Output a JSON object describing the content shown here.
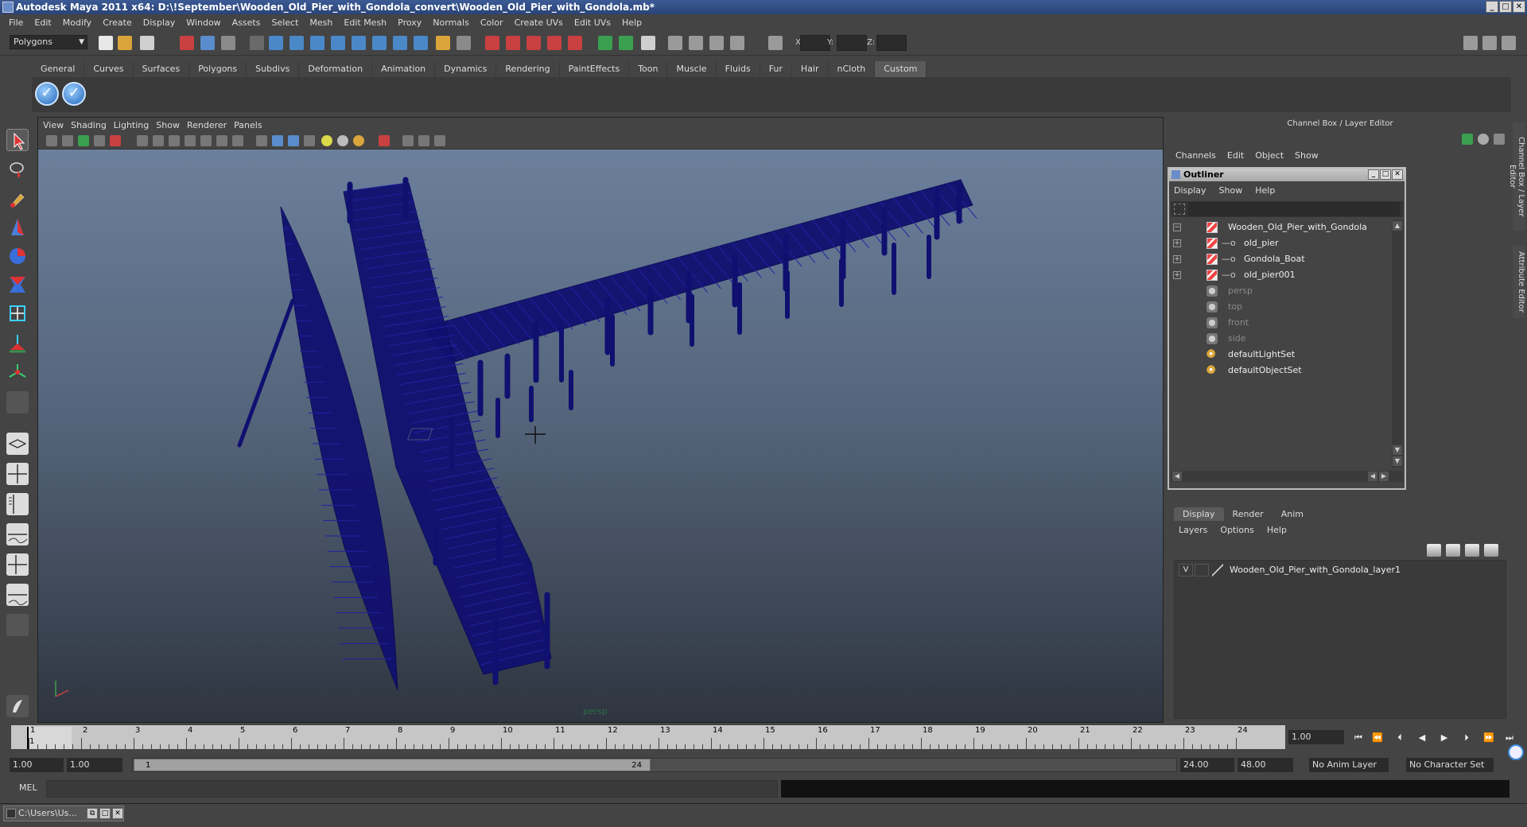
{
  "window": {
    "title": "Autodesk Maya 2011 x64: D:\\!September\\Wooden_Old_Pier_with_Gondola_convert\\Wooden_Old_Pier_with_Gondola.mb*",
    "min": "_",
    "max": "□",
    "close": "✕"
  },
  "menubar": [
    "File",
    "Edit",
    "Modify",
    "Create",
    "Display",
    "Window",
    "Assets",
    "Select",
    "Mesh",
    "Edit Mesh",
    "Proxy",
    "Normals",
    "Color",
    "Create UVs",
    "Edit UVs",
    "Help"
  ],
  "status": {
    "mode": "Polygons",
    "x_label": "X:",
    "y_label": "Y:",
    "z_label": "Z:"
  },
  "shelf": {
    "tabs": [
      "General",
      "Curves",
      "Surfaces",
      "Polygons",
      "Subdivs",
      "Deformation",
      "Animation",
      "Dynamics",
      "Rendering",
      "PaintEffects",
      "Toon",
      "Muscle",
      "Fluids",
      "Fur",
      "Hair",
      "nCloth",
      "Custom"
    ],
    "active_tab": "Custom"
  },
  "viewport": {
    "menu": [
      "View",
      "Shading",
      "Lighting",
      "Show",
      "Renderer",
      "Panels"
    ],
    "camera_label": "persp",
    "wire_color": "#101070",
    "bg_top": "#6e83a0",
    "bg_bottom": "#2f3540"
  },
  "channel_box": {
    "header": "Channel Box / Layer Editor",
    "menu": [
      "Channels",
      "Edit",
      "Object",
      "Show"
    ]
  },
  "outliner": {
    "title": "Outliner",
    "menu": [
      "Display",
      "Show",
      "Help"
    ],
    "items": [
      {
        "label": "Wooden_Old_Pier_with_Gondola",
        "kind": "transform",
        "expander": "−",
        "dim": false
      },
      {
        "label": "old_pier",
        "kind": "transform",
        "expander": "+",
        "dim": false
      },
      {
        "label": "Gondola_Boat",
        "kind": "transform",
        "expander": "+",
        "dim": false
      },
      {
        "label": "old_pier001",
        "kind": "transform",
        "expander": "+",
        "dim": false
      },
      {
        "label": "persp",
        "kind": "camera",
        "expander": "",
        "dim": true
      },
      {
        "label": "top",
        "kind": "camera",
        "expander": "",
        "dim": true
      },
      {
        "label": "front",
        "kind": "camera",
        "expander": "",
        "dim": true
      },
      {
        "label": "side",
        "kind": "camera",
        "expander": "",
        "dim": true
      },
      {
        "label": "defaultLightSet",
        "kind": "set",
        "expander": "",
        "dim": false
      },
      {
        "label": "defaultObjectSet",
        "kind": "set",
        "expander": "",
        "dim": false
      }
    ]
  },
  "layer_editor": {
    "tabs": [
      "Display",
      "Render",
      "Anim"
    ],
    "active_tab": "Display",
    "menu": [
      "Layers",
      "Options",
      "Help"
    ],
    "layer": {
      "visible": "V",
      "name": "Wooden_Old_Pier_with_Gondola_layer1"
    }
  },
  "side_tabs": [
    "Channel Box / Layer Editor",
    "Attribute Editor"
  ],
  "timeline": {
    "ticks": [
      "1",
      "2",
      "3",
      "4",
      "5",
      "6",
      "7",
      "8",
      "9",
      "10",
      "11",
      "12",
      "13",
      "14",
      "15",
      "16",
      "17",
      "18",
      "19",
      "20",
      "21",
      "22",
      "23",
      "24"
    ],
    "current_frame_marker": "1",
    "current_frame": "1.00",
    "buttons": [
      "⏮",
      "⏪",
      "⏴",
      "◀",
      "▶",
      "⏵",
      "⏩",
      "⏭"
    ]
  },
  "range": {
    "start": "1.00",
    "playback_start": "1.00",
    "slider_start": "1",
    "slider_end": "24",
    "playback_end": "24.00",
    "end": "48.00",
    "anim_layer": "No Anim Layer",
    "character_set": "No Character Set"
  },
  "command_line": {
    "label": "MEL"
  },
  "taskbar": {
    "item": "C:\\Users\\Us..."
  }
}
